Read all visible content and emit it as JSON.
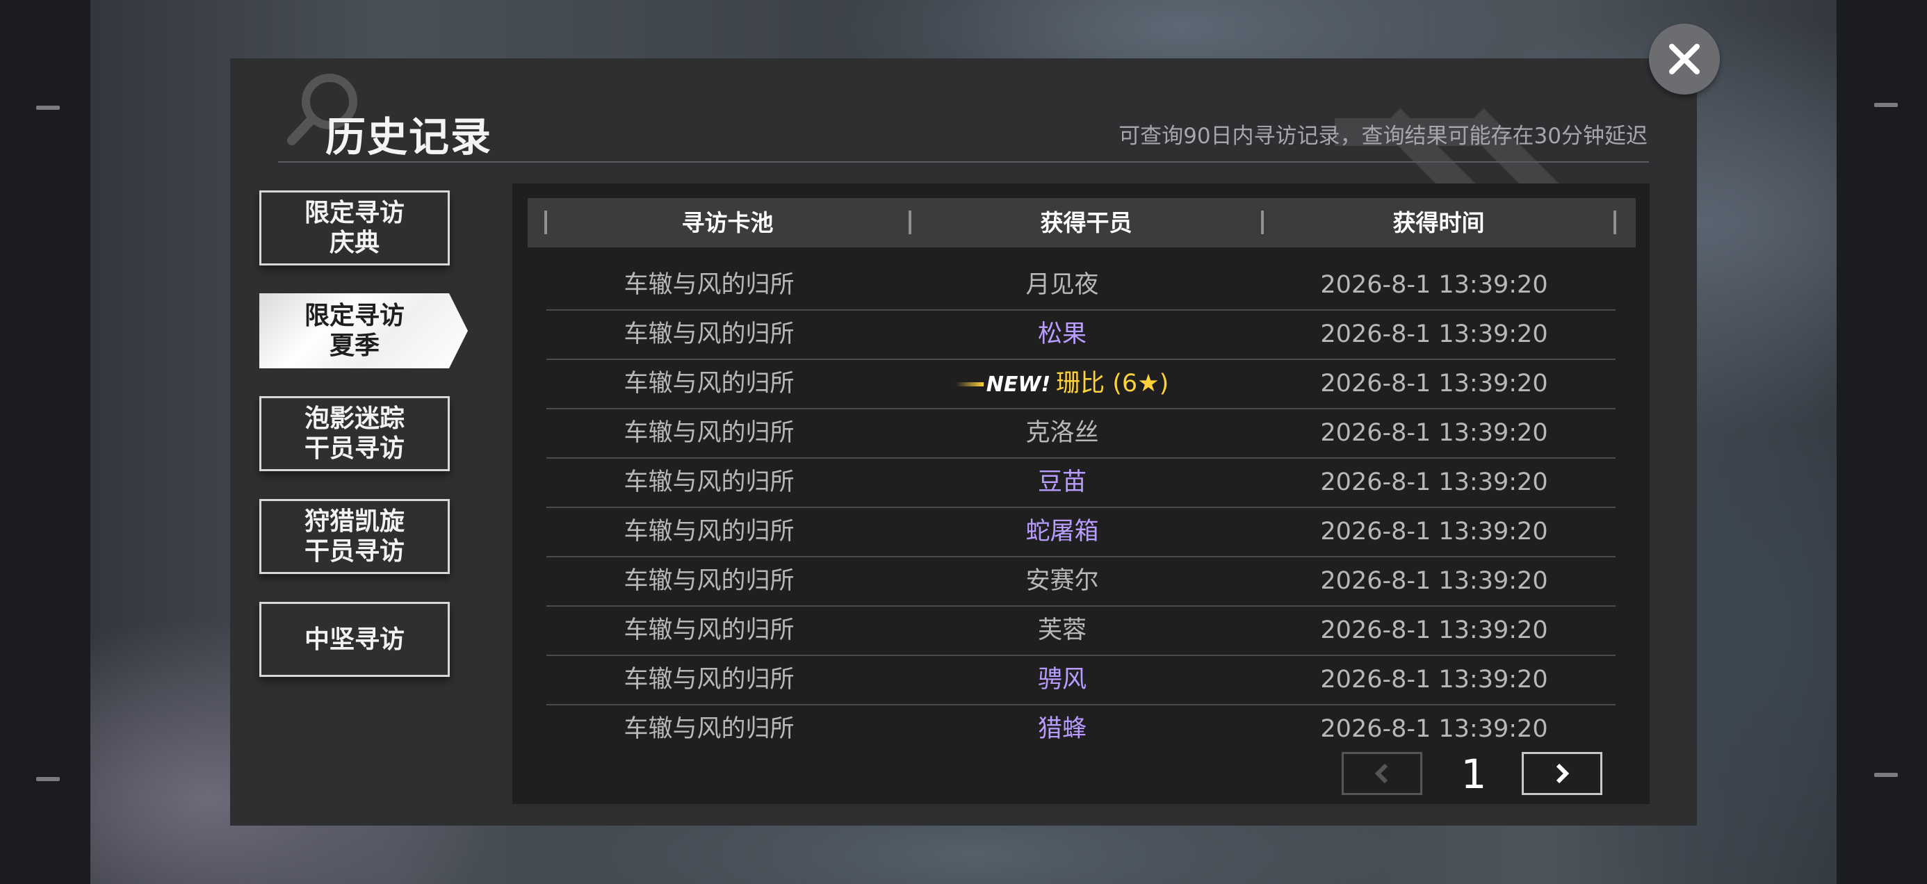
{
  "header": {
    "title": "历史记录",
    "subtitle": "可查询90日内寻访记录，查询结果可能存在30分钟延迟"
  },
  "tabs": [
    {
      "label": "限定寻访\n庆典",
      "active": false
    },
    {
      "label": "限定寻访\n夏季",
      "active": true
    },
    {
      "label": "泡影迷踪\n干员寻访",
      "active": false
    },
    {
      "label": "狩猎凯旋\n干员寻访",
      "active": false
    },
    {
      "label": "中坚寻访",
      "active": false
    }
  ],
  "table": {
    "columns": [
      "寻访卡池",
      "获得干员",
      "获得时间"
    ],
    "rows": [
      {
        "pool": "车辙与风的归所",
        "operator": "月见夜",
        "rarity": "normal",
        "time": "2026-8-1 13:39:20"
      },
      {
        "pool": "车辙与风的归所",
        "operator": "松果",
        "rarity": "5star",
        "time": "2026-8-1 13:39:20"
      },
      {
        "pool": "车辙与风的归所",
        "operator": "珊比 (6★)",
        "rarity": "6star",
        "is_new": true,
        "new_label": "NEW!",
        "time": "2026-8-1 13:39:20"
      },
      {
        "pool": "车辙与风的归所",
        "operator": "克洛丝",
        "rarity": "normal",
        "time": "2026-8-1 13:39:20"
      },
      {
        "pool": "车辙与风的归所",
        "operator": "豆苗",
        "rarity": "5star",
        "time": "2026-8-1 13:39:20"
      },
      {
        "pool": "车辙与风的归所",
        "operator": "蛇屠箱",
        "rarity": "5star",
        "time": "2026-8-1 13:39:20"
      },
      {
        "pool": "车辙与风的归所",
        "operator": "安赛尔",
        "rarity": "normal",
        "time": "2026-8-1 13:39:20"
      },
      {
        "pool": "车辙与风的归所",
        "operator": "芙蓉",
        "rarity": "normal",
        "time": "2026-8-1 13:39:20"
      },
      {
        "pool": "车辙与风的归所",
        "operator": "骋风",
        "rarity": "5star",
        "time": "2026-8-1 13:39:20"
      },
      {
        "pool": "车辙与风的归所",
        "operator": "猎蜂",
        "rarity": "5star",
        "time": "2026-8-1 13:39:20"
      }
    ]
  },
  "pagination": {
    "current_page": "1"
  },
  "icons": {
    "close": "close-icon",
    "prev": "chevron-left-icon",
    "next": "chevron-right-icon",
    "search_deco": "search-icon"
  },
  "colors": {
    "normal_operator": "#b8b8ba",
    "five_star_operator": "#b89cff",
    "six_star_operator": "#ffd23c"
  }
}
